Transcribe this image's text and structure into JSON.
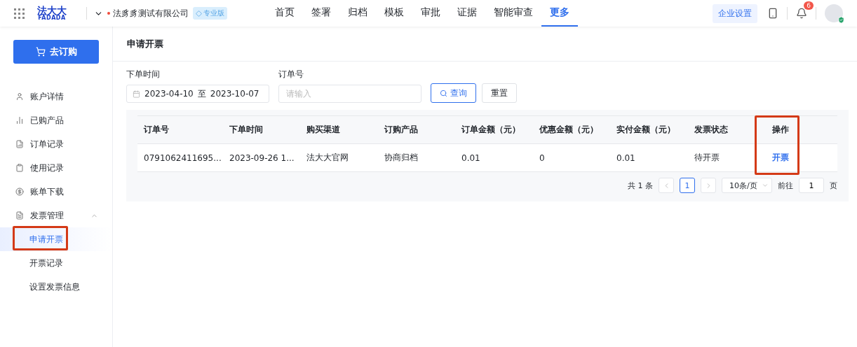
{
  "header": {
    "logo": {
      "mark": "法大大",
      "wordmark": "FADADA"
    },
    "company": "法豸豸测试有限公司",
    "edition": "专业版",
    "nav": [
      {
        "label": "首页",
        "selected": false
      },
      {
        "label": "签署",
        "selected": false
      },
      {
        "label": "归档",
        "selected": false
      },
      {
        "label": "模板",
        "selected": false
      },
      {
        "label": "审批",
        "selected": false
      },
      {
        "label": "证据",
        "selected": false
      },
      {
        "label": "智能审查",
        "selected": false
      },
      {
        "label": "更多",
        "selected": true
      }
    ],
    "settings_button": "企业设置",
    "notifications": "6"
  },
  "sidebar": {
    "order_button": "去订购",
    "items": [
      {
        "label": "账户详情"
      },
      {
        "label": "已购产品"
      },
      {
        "label": "订单记录"
      },
      {
        "label": "使用记录"
      },
      {
        "label": "账单下载"
      },
      {
        "label": "发票管理",
        "expanded": true,
        "children": [
          {
            "label": "申请开票",
            "selected": true,
            "highlighted": true
          },
          {
            "label": "开票记录",
            "selected": false,
            "highlighted": false
          },
          {
            "label": "设置发票信息",
            "selected": false,
            "highlighted": false
          }
        ]
      }
    ]
  },
  "page_title": "申请开票",
  "filters": {
    "date_label": "下单时间",
    "date_start": "2023-04-10",
    "date_sep": "至",
    "date_end": "2023-10-07",
    "order_label": "订单号",
    "order_placeholder": "请输入",
    "search_button": "查询",
    "reset_button": "重置"
  },
  "table": {
    "columns": [
      {
        "label": "订单号",
        "highlighted": false
      },
      {
        "label": "下单时间",
        "highlighted": false
      },
      {
        "label": "购买渠道",
        "highlighted": false
      },
      {
        "label": "订购产品",
        "highlighted": false
      },
      {
        "label": "订单金额（元）",
        "highlighted": false
      },
      {
        "label": "优惠金额（元）",
        "highlighted": false
      },
      {
        "label": "实付金额（元）",
        "highlighted": false
      },
      {
        "label": "发票状态",
        "highlighted": false
      },
      {
        "label": "操作",
        "highlighted": true
      }
    ],
    "rows": [
      {
        "cells": [
          "0791062411695...",
          "2023-09-26 1...",
          "法大大官网",
          "协商归档",
          "0.01",
          "0",
          "0.01",
          "待开票"
        ],
        "action": "开票"
      }
    ]
  },
  "pagination": {
    "total": "共 1 条",
    "pages": [
      {
        "label": "1",
        "selected": true
      }
    ],
    "page_size": "10条/页",
    "goto_label": "前往",
    "goto_value": "1",
    "goto_suffix": "页"
  }
}
